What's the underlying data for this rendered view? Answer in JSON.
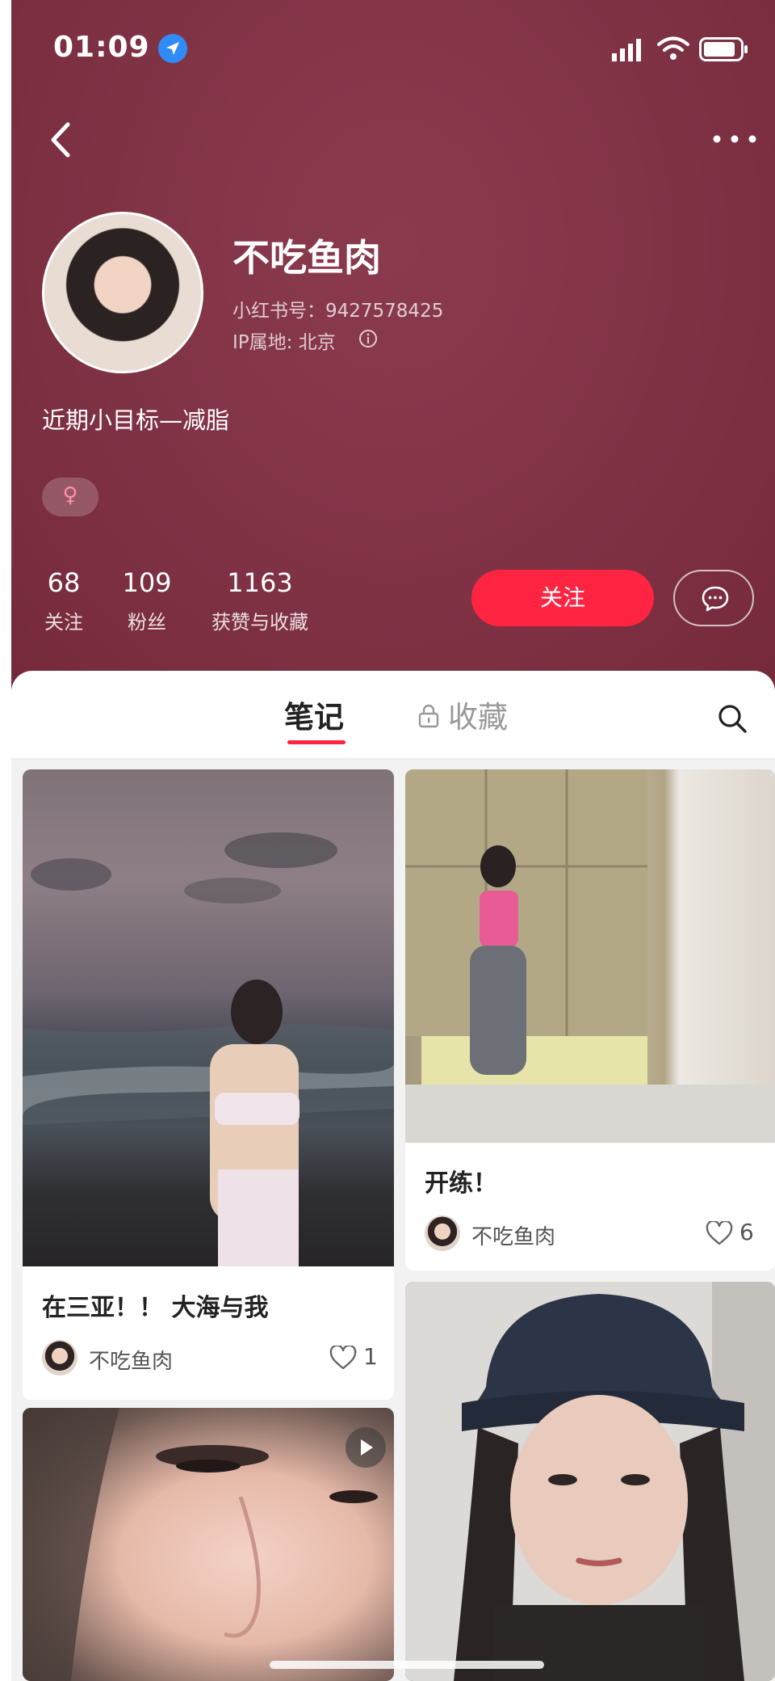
{
  "status_bar": {
    "time": "01:09",
    "icons": [
      "location-arrow-icon",
      "signal-icon",
      "wifi-icon",
      "battery-icon"
    ]
  },
  "nav": {
    "back_icon": "chevron-left-icon",
    "more_icon": "more-dots-icon"
  },
  "profile": {
    "name": "不吃鱼肉",
    "id_text": "小红书号：9427578425",
    "ip_text": "IP属地: 北京",
    "bio": "近期小目标—减脂",
    "gender_symbol": "♀"
  },
  "stats": [
    {
      "value": "68",
      "label": "关注"
    },
    {
      "value": "109",
      "label": "粉丝"
    },
    {
      "value": "1163",
      "label": "获赞与收藏"
    }
  ],
  "actions": {
    "follow_label": "关注"
  },
  "tabs": {
    "notes": "笔记",
    "collect": "收藏"
  },
  "notes": [
    {
      "title": "在三亚！！ 大海与我",
      "author": "不吃鱼肉",
      "likes": "1"
    },
    {
      "title": "开练！",
      "author": "不吃鱼肉",
      "likes": "6"
    },
    {
      "title": "",
      "author": "",
      "likes": ""
    },
    {
      "title": "",
      "author": "",
      "likes": ""
    }
  ],
  "colors": {
    "header_bg": "#823447",
    "accent": "#ff2442"
  }
}
